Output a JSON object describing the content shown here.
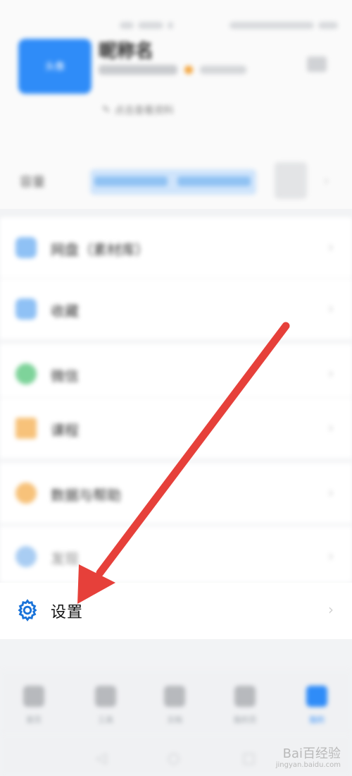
{
  "profile": {
    "avatar_text": "头像",
    "username": "昵称名",
    "subtitle": "点击查看资料"
  },
  "storage": {
    "label": "容量"
  },
  "menu": {
    "items": [
      {
        "label": "网盘（素材库）",
        "color": "#8fc1f5"
      },
      {
        "label": "收藏",
        "color": "#8fc1f5"
      },
      {
        "label": "微信",
        "color": "#7ed39a"
      },
      {
        "label": "课程",
        "color": "#f7c27a"
      },
      {
        "label": "数据与帮助",
        "color": "#f7c27a"
      },
      {
        "label": "发现",
        "color": "#a9cdf3"
      }
    ],
    "settings_label": "设置"
  },
  "tabbar": {
    "tabs": [
      {
        "label": "首页",
        "active": false
      },
      {
        "label": "工具",
        "active": false
      },
      {
        "label": "文档",
        "active": false
      },
      {
        "label": "我的页",
        "active": false
      },
      {
        "label": "我的",
        "active": true
      }
    ]
  },
  "colors": {
    "accent": "#2f8cf8",
    "arrow": "#e6403a",
    "gear": "#1a73d9"
  },
  "watermark": {
    "brand": "Bai百经验",
    "url": "jingyan.baidu.com"
  }
}
